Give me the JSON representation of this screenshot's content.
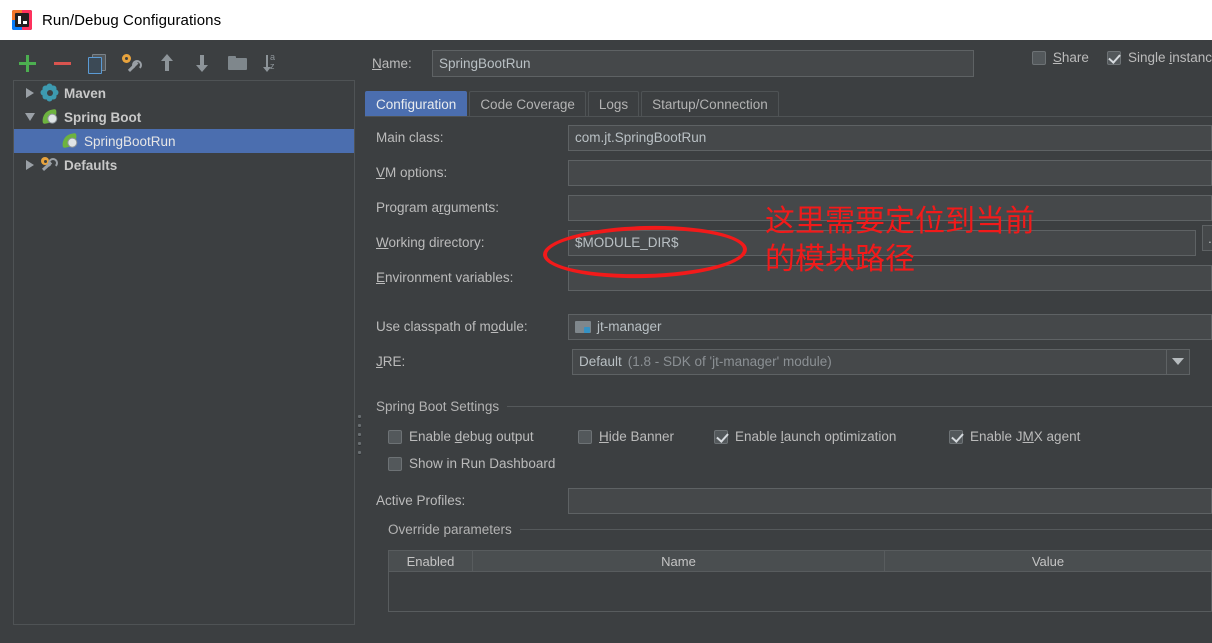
{
  "window": {
    "title": "Run/Debug Configurations",
    "logo_icon": "intellij-idea-logo"
  },
  "sidebar": {
    "toolbar": [
      {
        "name": "add",
        "icon": "plus-icon"
      },
      {
        "name": "remove",
        "icon": "minus-icon"
      },
      {
        "name": "copy",
        "icon": "copy-icon"
      },
      {
        "name": "edit-defaults",
        "icon": "wrench-gear-icon"
      },
      {
        "name": "move-up",
        "icon": "arrow-up-icon"
      },
      {
        "name": "move-down",
        "icon": "arrow-down-icon"
      },
      {
        "name": "create-folder",
        "icon": "folder-icon"
      },
      {
        "name": "sort-alphabetically",
        "icon": "sort-az-icon"
      }
    ],
    "tree": [
      {
        "label": "Maven",
        "icon": "maven-gear-icon",
        "expander": "collapsed",
        "indent": 0,
        "selected": false,
        "bold": true
      },
      {
        "label": "Spring Boot",
        "icon": "spring-leaf-icon",
        "expander": "expanded",
        "indent": 0,
        "selected": false,
        "bold": true
      },
      {
        "label": "SpringBootRun",
        "icon": "spring-leaf-icon",
        "expander": "none",
        "indent": 1,
        "selected": true,
        "bold": false
      },
      {
        "label": "Defaults",
        "icon": "wrench-gear-icon",
        "expander": "collapsed",
        "indent": 0,
        "selected": false,
        "bold": true
      }
    ]
  },
  "header": {
    "name_label": "Name:",
    "name_value": "SpringBootRun",
    "share": {
      "label": "Share",
      "checked": false
    },
    "single_instance": {
      "label": "Single instanc",
      "checked": true
    }
  },
  "tabs": [
    {
      "label": "Configuration",
      "active": true
    },
    {
      "label": "Code Coverage",
      "active": false
    },
    {
      "label": "Logs",
      "active": false
    },
    {
      "label": "Startup/Connection",
      "active": false
    }
  ],
  "form": {
    "main_class": {
      "label": "Main class:",
      "value": "com.jt.SpringBootRun"
    },
    "vm_options": {
      "label": "VM options:",
      "value": ""
    },
    "program_arguments": {
      "label": "Program arguments:",
      "value": ""
    },
    "working_directory": {
      "label": "Working directory:",
      "value": "$MODULE_DIR$",
      "browse_button": "..."
    },
    "environment_variables": {
      "label": "Environment variables:",
      "value": ""
    },
    "use_classpath_of_module": {
      "label": "Use classpath of module:",
      "value": "jt-manager",
      "icon": "module-icon"
    },
    "jre": {
      "label": "JRE:",
      "value": "Default",
      "value_hint": "(1.8 - SDK of 'jt-manager' module)"
    }
  },
  "spring_boot_settings": {
    "title": "Spring Boot Settings",
    "checkboxes": [
      {
        "label": "Enable debug output",
        "checked": false
      },
      {
        "label": "Hide Banner",
        "checked": false
      },
      {
        "label": "Enable launch optimization",
        "checked": true
      },
      {
        "label": "Enable JMX agent",
        "checked": true
      },
      {
        "label": "Show in Run Dashboard",
        "checked": false
      }
    ],
    "active_profiles": {
      "label": "Active Profiles:",
      "value": ""
    }
  },
  "override_parameters": {
    "title": "Override parameters",
    "columns": [
      "Enabled",
      "Name",
      "Value"
    ],
    "rows": []
  },
  "annotation": {
    "text": "这里需要定位到当前\n的模块路径",
    "color": "#f21a1a",
    "shape": "ellipse"
  }
}
